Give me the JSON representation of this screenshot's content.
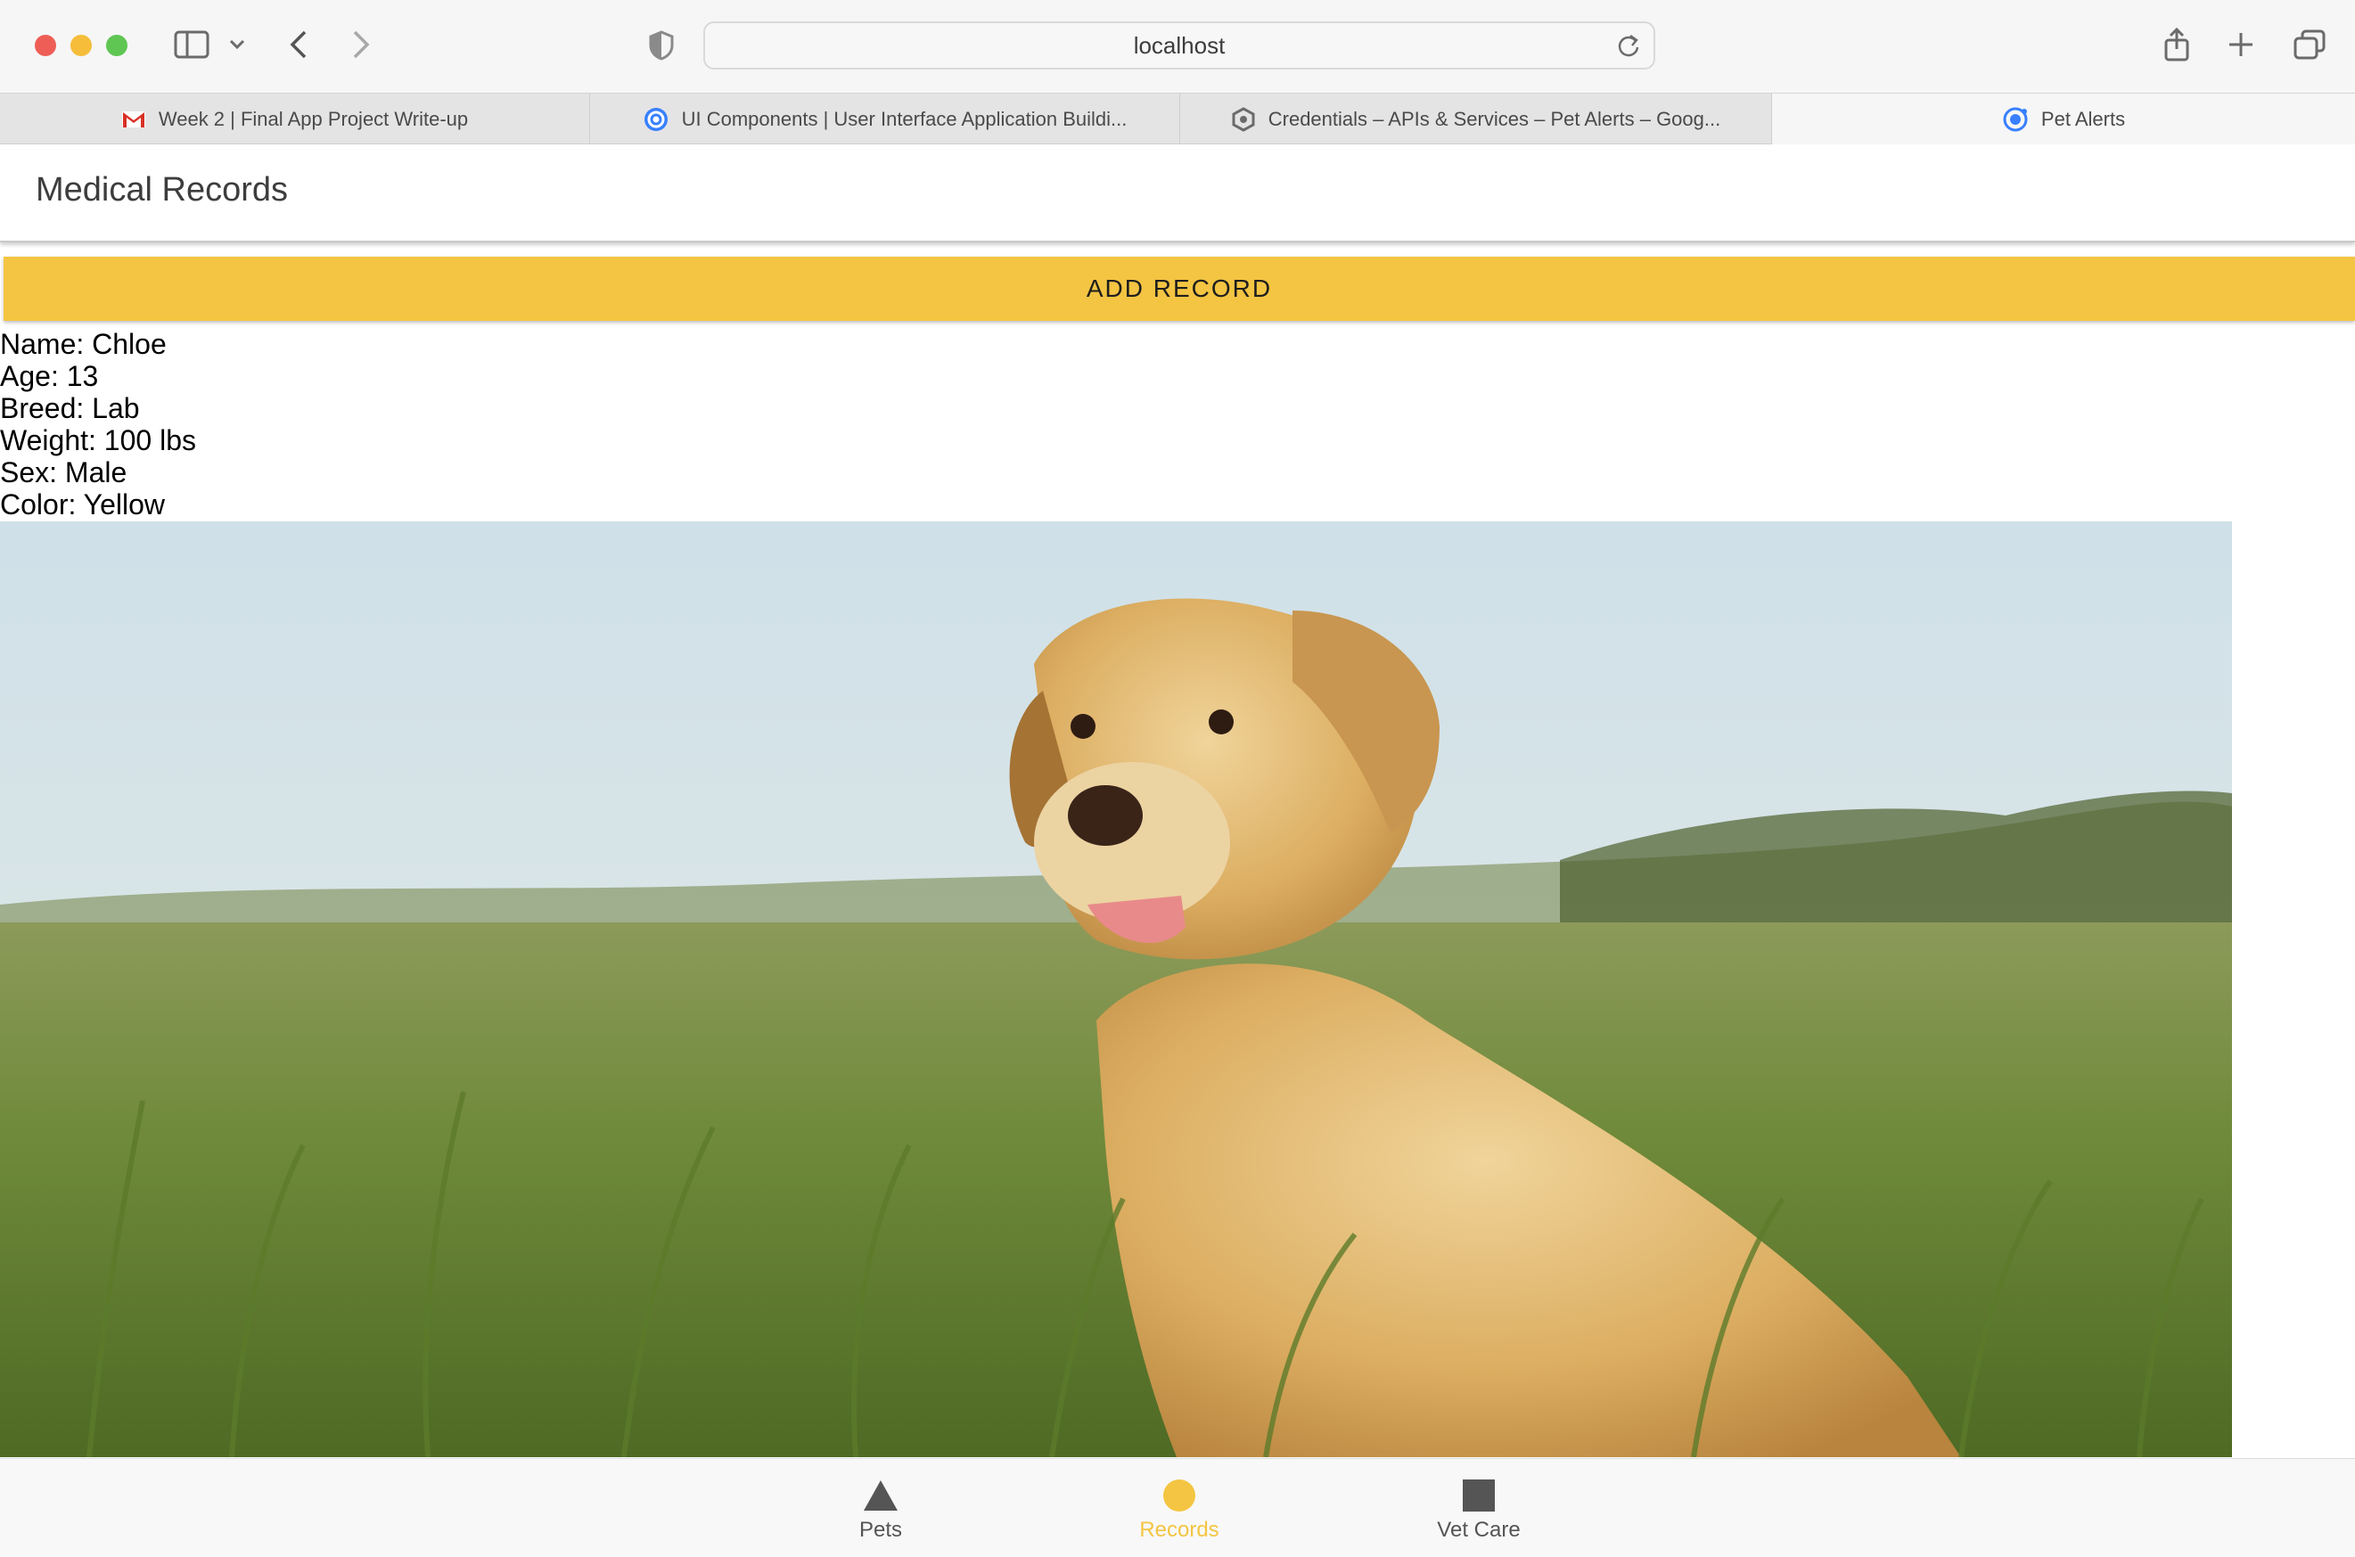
{
  "browser": {
    "url": "localhost",
    "tabs": [
      {
        "title": "Week 2 | Final App Project Write-up",
        "icon": "gmail-icon"
      },
      {
        "title": "UI Components | User Interface Application Buildi...",
        "icon": "ionic-icon"
      },
      {
        "title": "Credentials – APIs & Services – Pet Alerts – Goog...",
        "icon": "google-cloud-icon"
      },
      {
        "title": "Pet Alerts",
        "icon": "ionic-icon",
        "active": true
      }
    ]
  },
  "header": {
    "title": "Medical Records"
  },
  "actions": {
    "add_record_label": "ADD RECORD"
  },
  "pet": {
    "name": "Name: Chloe",
    "age": "Age: 13",
    "breed": "Breed: Lab",
    "weight": "Weight: 100 lbs",
    "sex": "Sex: Male",
    "color": "Color: Yellow"
  },
  "photo": {
    "subject": "yellow labrador sitting in tall grass"
  },
  "tab_nav": {
    "items": [
      {
        "label": "Pets",
        "icon": "triangle-icon"
      },
      {
        "label": "Records",
        "icon": "circle-icon",
        "active": true
      },
      {
        "label": "Vet Care",
        "icon": "square-icon"
      }
    ]
  },
  "colors": {
    "accent": "#f4c542",
    "nav_inactive": "#555555"
  }
}
